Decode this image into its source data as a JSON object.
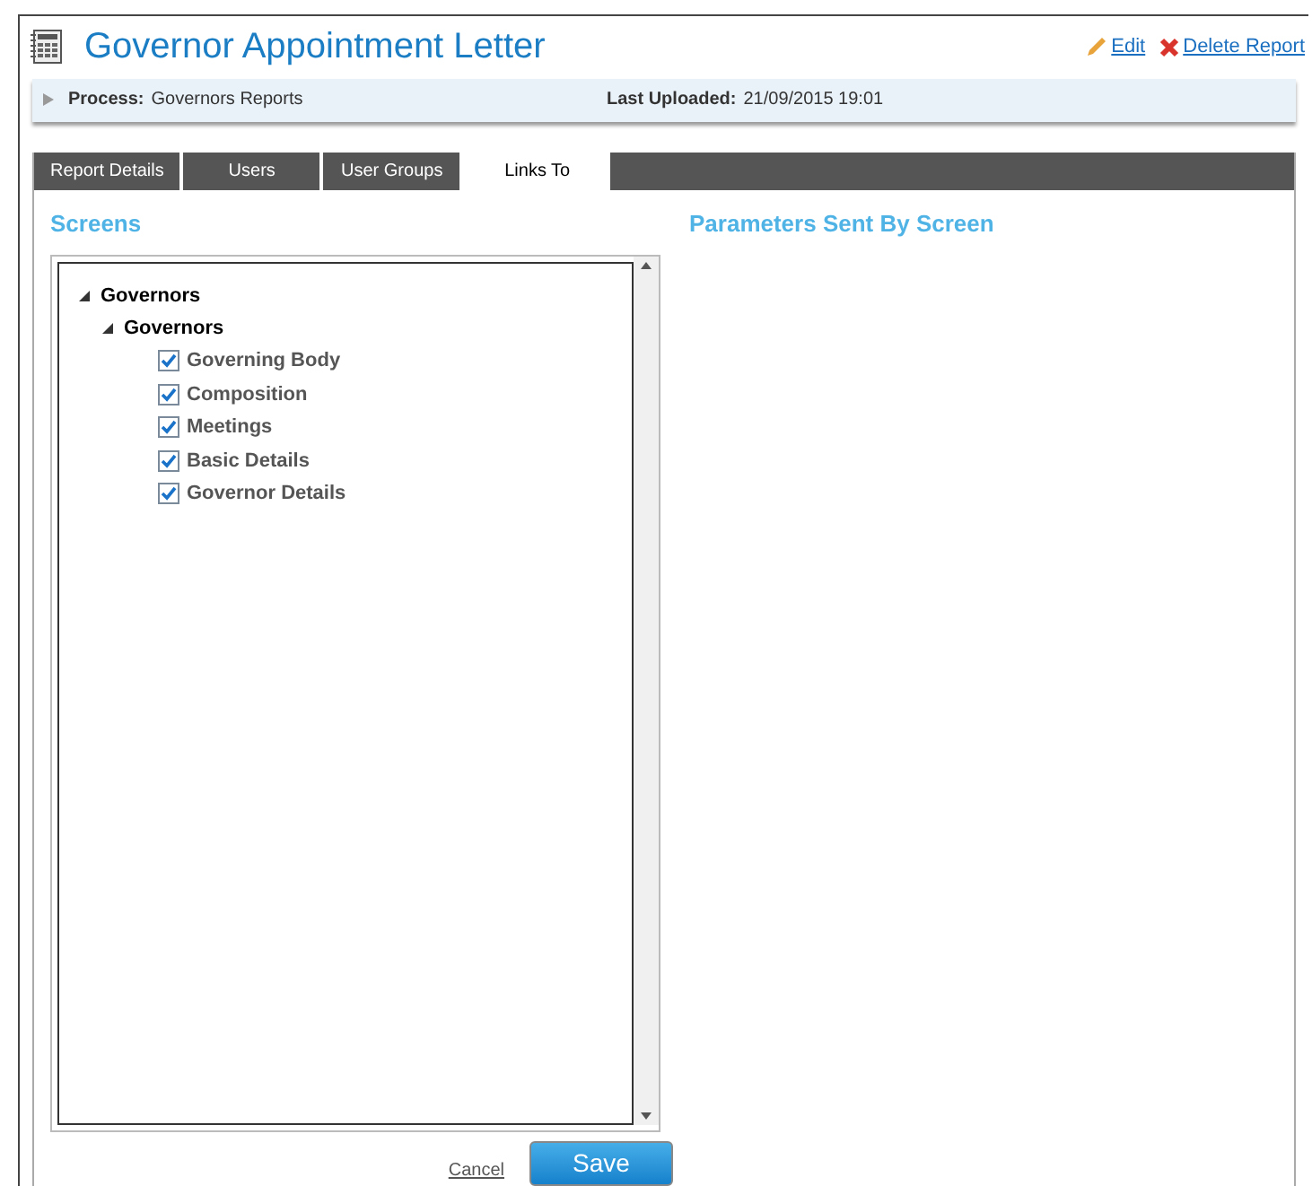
{
  "title": "Governor Appointment Letter",
  "actions": [
    {
      "kind": "edit",
      "label": "Edit"
    },
    {
      "kind": "delete",
      "label": "Delete Report"
    }
  ],
  "info_bar": {
    "expanded": false,
    "fields": [
      {
        "label": "Process:",
        "value": "Governors Reports"
      },
      {
        "label": "Last Uploaded:",
        "value": "21/09/2015 19:01"
      }
    ]
  },
  "tabs": [
    {
      "label": "Report Details",
      "selected": false
    },
    {
      "label": "Users",
      "selected": false
    },
    {
      "label": "User Groups",
      "selected": false
    },
    {
      "label": "Links To",
      "selected": true
    }
  ],
  "screens": {
    "heading": "Screens",
    "tree": [
      {
        "label": "Governors",
        "expanded": true,
        "children": [
          {
            "label": "Governors",
            "expanded": true,
            "children": [
              {
                "label": "Governing Body",
                "checked": true
              },
              {
                "label": "Composition",
                "checked": true
              },
              {
                "label": "Meetings",
                "checked": true
              },
              {
                "label": "Basic Details",
                "checked": true
              },
              {
                "label": "Governor Details",
                "checked": true
              }
            ]
          }
        ]
      }
    ]
  },
  "parameters": {
    "heading": "Parameters Sent By Screen"
  },
  "buttons": {
    "cancel": "Cancel",
    "save": "Save"
  }
}
